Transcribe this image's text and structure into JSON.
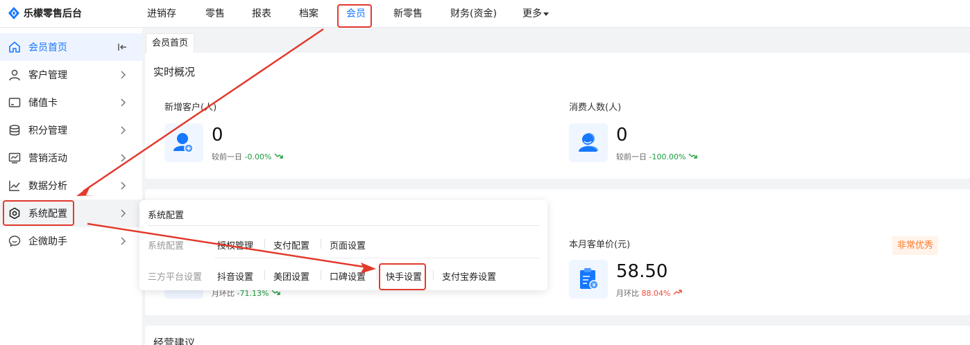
{
  "brand": {
    "name": "乐檬零售后台"
  },
  "topnav": {
    "items": [
      "进销存",
      "零售",
      "报表",
      "档案",
      "会员",
      "新零售",
      "财务(资金)",
      "更多"
    ],
    "active": "会员"
  },
  "sidebar": {
    "items": [
      {
        "label": "会员首页",
        "icon": "home-icon"
      },
      {
        "label": "客户管理",
        "icon": "user-icon"
      },
      {
        "label": "储值卡",
        "icon": "card-icon"
      },
      {
        "label": "积分管理",
        "icon": "coins-icon"
      },
      {
        "label": "营销活动",
        "icon": "campaign-icon"
      },
      {
        "label": "数据分析",
        "icon": "chart-icon"
      },
      {
        "label": "系统配置",
        "icon": "settings-hex-icon"
      },
      {
        "label": "企微助手",
        "icon": "chat-icon"
      }
    ]
  },
  "tab": {
    "label": "会员首页"
  },
  "realtime": {
    "title": "实时概况",
    "stats": [
      {
        "label": "新增客户(人)",
        "value": "0",
        "compare_label": "较前一日",
        "compare_value": "-0.00%",
        "trend": "down"
      },
      {
        "label": "消费人数(人)",
        "value": "0",
        "compare_label": "较前一日",
        "compare_value": "-100.00%",
        "trend": "down"
      }
    ]
  },
  "monthly": {
    "label": "本月客单价(元)",
    "value": "58.50",
    "compare_label": "月环比",
    "compare_value": "88.04%",
    "trend": "up",
    "badge": "非常优秀",
    "left_compare_label": "月环比",
    "left_compare_value": "-71.13%"
  },
  "advice": {
    "title": "经营建议"
  },
  "popup": {
    "title": "系统配置",
    "groups": [
      {
        "name": "系统配置",
        "links": [
          "授权管理",
          "支付配置",
          "页面设置"
        ]
      },
      {
        "name": "三方平台设置",
        "links": [
          "抖音设置",
          "美团设置",
          "口碑设置",
          "快手设置",
          "支付宝券设置"
        ]
      }
    ]
  },
  "colors": {
    "accent": "#1677ff",
    "annotation": "#e23a2c",
    "positive": "#1a9c3e",
    "negative": "#f04b3a",
    "badge": "#ff7a2e"
  }
}
